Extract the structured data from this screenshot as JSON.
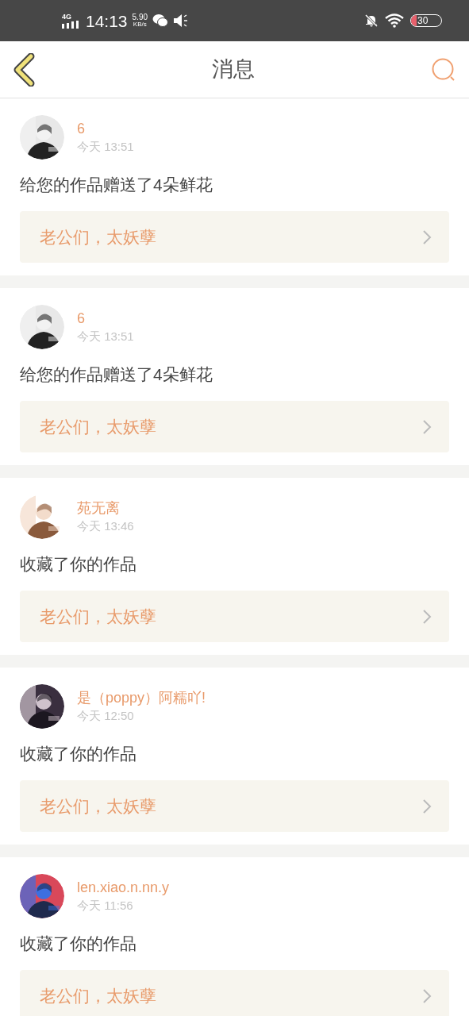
{
  "status_bar": {
    "network": "4G",
    "time": "14:13",
    "speed": "5.90",
    "speed_unit": "KB/s",
    "battery": "30"
  },
  "header": {
    "title": "消息"
  },
  "messages": [
    {
      "name": "6",
      "time": "今天 13:51",
      "text": "给您的作品赠送了4朵鲜花",
      "quote": "老公们，太妖孽"
    },
    {
      "name": "6",
      "time": "今天 13:51",
      "text": "给您的作品赠送了4朵鲜花",
      "quote": "老公们，太妖孽"
    },
    {
      "name": "苑无离",
      "time": "今天 13:46",
      "text": "收藏了你的作品",
      "quote": "老公们，太妖孽"
    },
    {
      "name": "是（poppy）阿糯吖!",
      "time": "今天 12:50",
      "text": "收藏了你的作品",
      "quote": "老公们，太妖孽"
    },
    {
      "name": "len.xiao.n.nn.y",
      "time": "今天 11:56",
      "text": "收藏了你的作品",
      "quote": "老公们，太妖孽"
    }
  ]
}
